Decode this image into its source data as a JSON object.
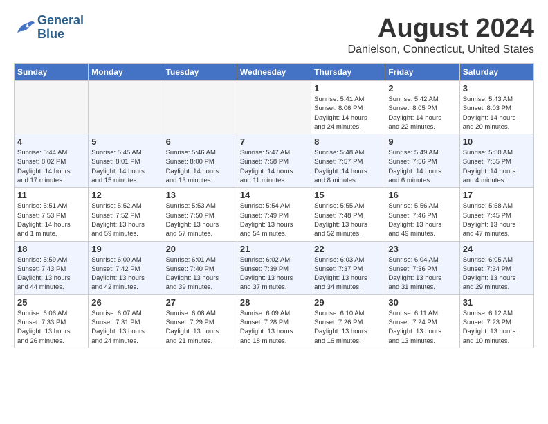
{
  "header": {
    "logo_line1": "General",
    "logo_line2": "Blue",
    "month_title": "August 2024",
    "location": "Danielson, Connecticut, United States"
  },
  "days_of_week": [
    "Sunday",
    "Monday",
    "Tuesday",
    "Wednesday",
    "Thursday",
    "Friday",
    "Saturday"
  ],
  "weeks": [
    [
      {
        "day": "",
        "info": ""
      },
      {
        "day": "",
        "info": ""
      },
      {
        "day": "",
        "info": ""
      },
      {
        "day": "",
        "info": ""
      },
      {
        "day": "1",
        "info": "Sunrise: 5:41 AM\nSunset: 8:06 PM\nDaylight: 14 hours\nand 24 minutes."
      },
      {
        "day": "2",
        "info": "Sunrise: 5:42 AM\nSunset: 8:05 PM\nDaylight: 14 hours\nand 22 minutes."
      },
      {
        "day": "3",
        "info": "Sunrise: 5:43 AM\nSunset: 8:03 PM\nDaylight: 14 hours\nand 20 minutes."
      }
    ],
    [
      {
        "day": "4",
        "info": "Sunrise: 5:44 AM\nSunset: 8:02 PM\nDaylight: 14 hours\nand 17 minutes."
      },
      {
        "day": "5",
        "info": "Sunrise: 5:45 AM\nSunset: 8:01 PM\nDaylight: 14 hours\nand 15 minutes."
      },
      {
        "day": "6",
        "info": "Sunrise: 5:46 AM\nSunset: 8:00 PM\nDaylight: 14 hours\nand 13 minutes."
      },
      {
        "day": "7",
        "info": "Sunrise: 5:47 AM\nSunset: 7:58 PM\nDaylight: 14 hours\nand 11 minutes."
      },
      {
        "day": "8",
        "info": "Sunrise: 5:48 AM\nSunset: 7:57 PM\nDaylight: 14 hours\nand 8 minutes."
      },
      {
        "day": "9",
        "info": "Sunrise: 5:49 AM\nSunset: 7:56 PM\nDaylight: 14 hours\nand 6 minutes."
      },
      {
        "day": "10",
        "info": "Sunrise: 5:50 AM\nSunset: 7:55 PM\nDaylight: 14 hours\nand 4 minutes."
      }
    ],
    [
      {
        "day": "11",
        "info": "Sunrise: 5:51 AM\nSunset: 7:53 PM\nDaylight: 14 hours\nand 1 minute."
      },
      {
        "day": "12",
        "info": "Sunrise: 5:52 AM\nSunset: 7:52 PM\nDaylight: 13 hours\nand 59 minutes."
      },
      {
        "day": "13",
        "info": "Sunrise: 5:53 AM\nSunset: 7:50 PM\nDaylight: 13 hours\nand 57 minutes."
      },
      {
        "day": "14",
        "info": "Sunrise: 5:54 AM\nSunset: 7:49 PM\nDaylight: 13 hours\nand 54 minutes."
      },
      {
        "day": "15",
        "info": "Sunrise: 5:55 AM\nSunset: 7:48 PM\nDaylight: 13 hours\nand 52 minutes."
      },
      {
        "day": "16",
        "info": "Sunrise: 5:56 AM\nSunset: 7:46 PM\nDaylight: 13 hours\nand 49 minutes."
      },
      {
        "day": "17",
        "info": "Sunrise: 5:58 AM\nSunset: 7:45 PM\nDaylight: 13 hours\nand 47 minutes."
      }
    ],
    [
      {
        "day": "18",
        "info": "Sunrise: 5:59 AM\nSunset: 7:43 PM\nDaylight: 13 hours\nand 44 minutes."
      },
      {
        "day": "19",
        "info": "Sunrise: 6:00 AM\nSunset: 7:42 PM\nDaylight: 13 hours\nand 42 minutes."
      },
      {
        "day": "20",
        "info": "Sunrise: 6:01 AM\nSunset: 7:40 PM\nDaylight: 13 hours\nand 39 minutes."
      },
      {
        "day": "21",
        "info": "Sunrise: 6:02 AM\nSunset: 7:39 PM\nDaylight: 13 hours\nand 37 minutes."
      },
      {
        "day": "22",
        "info": "Sunrise: 6:03 AM\nSunset: 7:37 PM\nDaylight: 13 hours\nand 34 minutes."
      },
      {
        "day": "23",
        "info": "Sunrise: 6:04 AM\nSunset: 7:36 PM\nDaylight: 13 hours\nand 31 minutes."
      },
      {
        "day": "24",
        "info": "Sunrise: 6:05 AM\nSunset: 7:34 PM\nDaylight: 13 hours\nand 29 minutes."
      }
    ],
    [
      {
        "day": "25",
        "info": "Sunrise: 6:06 AM\nSunset: 7:33 PM\nDaylight: 13 hours\nand 26 minutes."
      },
      {
        "day": "26",
        "info": "Sunrise: 6:07 AM\nSunset: 7:31 PM\nDaylight: 13 hours\nand 24 minutes."
      },
      {
        "day": "27",
        "info": "Sunrise: 6:08 AM\nSunset: 7:29 PM\nDaylight: 13 hours\nand 21 minutes."
      },
      {
        "day": "28",
        "info": "Sunrise: 6:09 AM\nSunset: 7:28 PM\nDaylight: 13 hours\nand 18 minutes."
      },
      {
        "day": "29",
        "info": "Sunrise: 6:10 AM\nSunset: 7:26 PM\nDaylight: 13 hours\nand 16 minutes."
      },
      {
        "day": "30",
        "info": "Sunrise: 6:11 AM\nSunset: 7:24 PM\nDaylight: 13 hours\nand 13 minutes."
      },
      {
        "day": "31",
        "info": "Sunrise: 6:12 AM\nSunset: 7:23 PM\nDaylight: 13 hours\nand 10 minutes."
      }
    ]
  ]
}
